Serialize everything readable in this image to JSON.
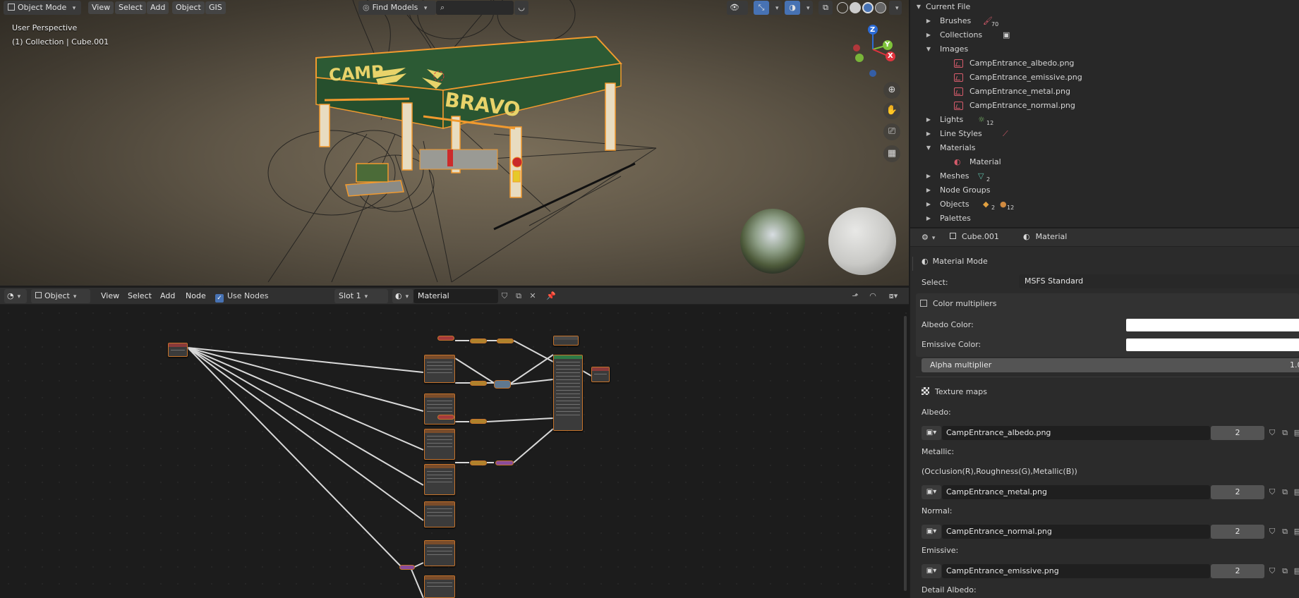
{
  "viewport": {
    "header": {
      "mode": "Object Mode",
      "menus": [
        "View",
        "Select",
        "Add",
        "Object",
        "GIS"
      ],
      "find_models": "Find Models"
    },
    "overlay": {
      "perspective": "User Perspective",
      "collection": "(1) Collection | Cube.001"
    },
    "scene_text": {
      "sign_left": "CAMP",
      "sign_right": "BRAVO"
    },
    "gizmo": {
      "z": "Z",
      "y": "Y",
      "x": "X"
    }
  },
  "node_editor": {
    "header": {
      "object_type": "Object",
      "menus": [
        "View",
        "Select",
        "Add",
        "Node"
      ],
      "use_nodes_label": "Use Nodes",
      "use_nodes_checked": true,
      "slot": "Slot 1",
      "material": "Material"
    }
  },
  "outliner": {
    "title": "Current File",
    "rows": [
      {
        "label": "Brushes",
        "expanded": false,
        "badge": "70",
        "icon": "brush-icon"
      },
      {
        "label": "Collections",
        "expanded": false,
        "icon": "collection-icon"
      },
      {
        "label": "Images",
        "expanded": true
      },
      {
        "label": "CampEntrance_albedo.png",
        "child": true,
        "icon": "image-icon"
      },
      {
        "label": "CampEntrance_emissive.png",
        "child": true,
        "icon": "image-icon"
      },
      {
        "label": "CampEntrance_metal.png",
        "child": true,
        "icon": "image-icon"
      },
      {
        "label": "CampEntrance_normal.png",
        "child": true,
        "icon": "image-icon"
      },
      {
        "label": "Lights",
        "expanded": false,
        "badge": "12",
        "icon": "light-icon"
      },
      {
        "label": "Line Styles",
        "expanded": false,
        "icon": "linestyle-icon"
      },
      {
        "label": "Materials",
        "expanded": true
      },
      {
        "label": "Material",
        "child": true,
        "icon": "material-icon"
      },
      {
        "label": "Meshes",
        "expanded": false,
        "badge": "2",
        "icon": "mesh-icon"
      },
      {
        "label": "Node Groups",
        "expanded": false
      },
      {
        "label": "Objects",
        "expanded": false,
        "badge": "2",
        "badge2": "12",
        "icon": "object-icon"
      },
      {
        "label": "Palettes",
        "expanded": false
      }
    ]
  },
  "properties": {
    "header": {
      "object": "Cube.001",
      "material": "Material"
    },
    "material_mode": "Material Mode",
    "select_label": "Select:",
    "select_value": "MSFS Standard",
    "color_multipliers": {
      "title": "Color multipliers",
      "albedo_label": "Albedo Color:",
      "emissive_label": "Emissive Color:",
      "alpha_label": "Alpha multiplier",
      "alpha_value": "1.0"
    },
    "texture_maps": {
      "title": "Texture maps",
      "albedo_label": "Albedo:",
      "albedo_file": "CampEntrance_albedo.png",
      "albedo_users": "2",
      "metallic_label": "Metallic:",
      "metallic_note": "(Occlusion(R),Roughness(G),Metallic(B))",
      "metal_file": "CampEntrance_metal.png",
      "metal_users": "2",
      "normal_label": "Normal:",
      "normal_file": "CampEntrance_normal.png",
      "normal_users": "2",
      "emissive_label": "Emissive:",
      "emissive_file": "CampEntrance_emissive.png",
      "emissive_users": "2",
      "detail_albedo_label": "Detail Albedo:"
    }
  }
}
